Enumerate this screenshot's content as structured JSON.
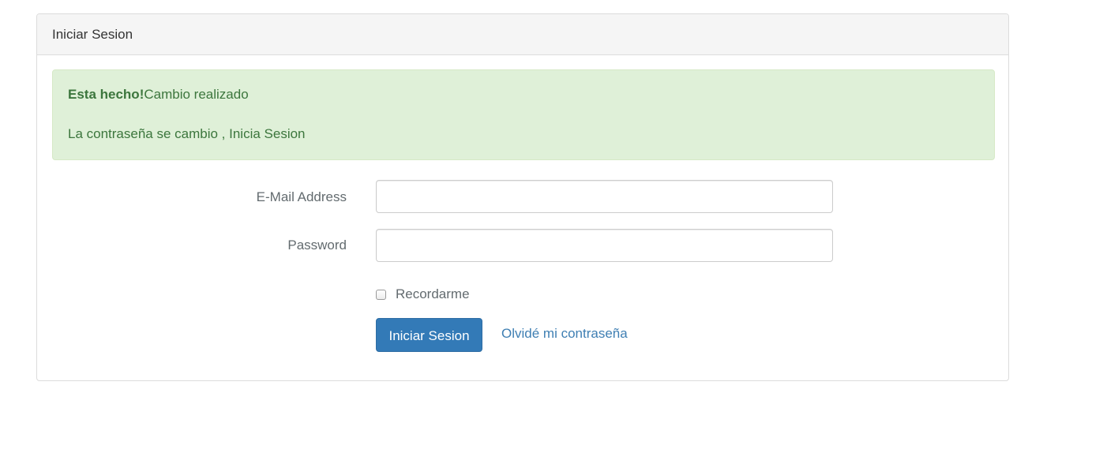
{
  "panel": {
    "title": "Iniciar Sesion"
  },
  "alert": {
    "strong": "Esta hecho!",
    "message": "Cambio realizado",
    "detail": "La contraseña se cambio , Inicia Sesion",
    "color": "#3c763d",
    "background": "#dff0d8"
  },
  "form": {
    "email_label": "E-Mail Address",
    "email_value": "",
    "password_label": "Password",
    "password_value": "",
    "remember_label": "Recordarme",
    "remember_checked": false,
    "submit_label": "Iniciar Sesion",
    "forgot_label": "Olvidé mi contraseña"
  },
  "colors": {
    "primary": "#337ab7",
    "link": "#3f7fb3"
  }
}
